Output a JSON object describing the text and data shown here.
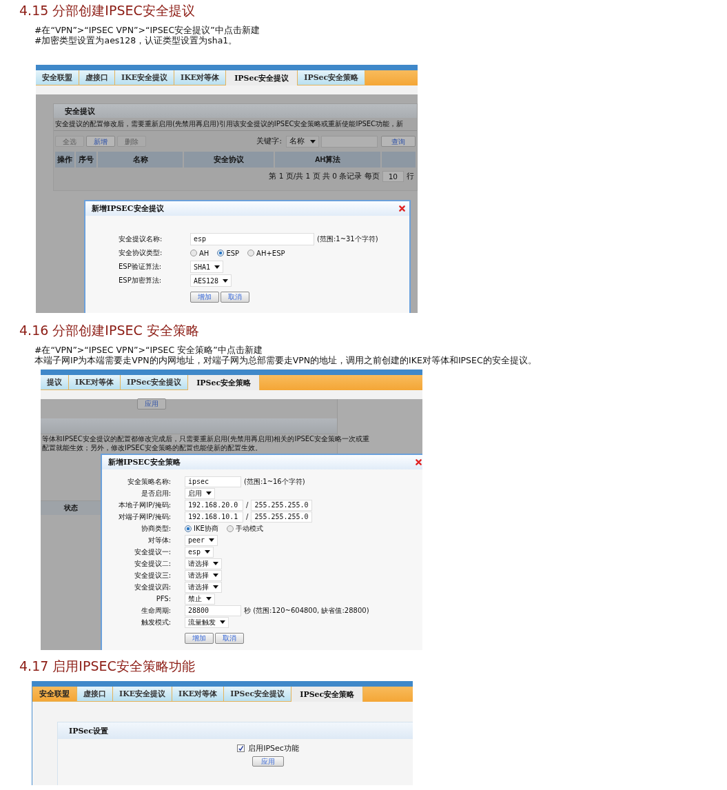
{
  "sections": [
    {
      "heading": "4.15  分部创建IPSEC安全提议",
      "notes": [
        "#在“VPN”>“IPSEC VPN”>“IPSEC安全提议”中点击新建",
        "#加密类型设置为aes128，认证类型设置为sha1。"
      ],
      "screenshot": {
        "kind": "proposal_list",
        "tabs": [
          {
            "label": "安全联盟",
            "selected": false
          },
          {
            "label": "虚接口",
            "selected": false
          },
          {
            "label": "IKE安全提议",
            "selected": false
          },
          {
            "label": "IKE对等体",
            "selected": false
          },
          {
            "label": "IPSec安全提议",
            "selected": true
          },
          {
            "label": "IPSec安全策略",
            "selected": false
          }
        ],
        "panel_title": "安全提议",
        "notice_lines": [
          "安全提议的配置修改后，需要重新启用(先禁用再启用)引用该安全提议的IPSEC安全策略或重新使能IPSEC功能，新"
        ],
        "toolbar_buttons": [
          {
            "label": "全选",
            "disabled": true
          },
          {
            "label": "新增",
            "disabled": false
          },
          {
            "label": "删除",
            "disabled": true
          }
        ],
        "search": {
          "label": "关键字:",
          "field": "名称",
          "button": "查询"
        },
        "columns": [
          "操作",
          "序号",
          "名称",
          "安全协议",
          "AH算法"
        ],
        "pager": {
          "before": "第 1 页/共 1 页 共 0 条记录 每页",
          "per_page": "10",
          "after": "行"
        },
        "dialog": {
          "title": "新增IPSEC安全提议",
          "fields": [
            {
              "kind": "text",
              "label": "安全提议名称:",
              "value": "esp",
              "hint": "(范围:1~31个字符)"
            },
            {
              "kind": "radio",
              "label": "安全协议类型:",
              "options": [
                {
                  "label": "AH",
                  "selected": false
                },
                {
                  "label": "ESP",
                  "selected": true
                },
                {
                  "label": "AH+ESP",
                  "selected": false
                }
              ]
            },
            {
              "kind": "select",
              "label": "ESP验证算法:",
              "value": "SHA1"
            },
            {
              "kind": "select",
              "label": "ESP加密算法:",
              "value": "AES128"
            }
          ],
          "buttons": [
            "增加",
            "取消"
          ]
        }
      }
    },
    {
      "heading": "4.16  分部创建IPSEC 安全策略",
      "notes": [
        "#在“VPN”>“IPSEC VPN”>“IPSEC 安全策略”中点击新建",
        "本端子网IP为本端需要走VPN的内网地址，对端子网为总部需要走VPN的地址，调用之前创建的IKE对等体和IPSEC的安全提议。"
      ],
      "screenshot": {
        "kind": "policy_list",
        "tabs": [
          {
            "label": "提议",
            "selected": false
          },
          {
            "label": "IKE对等体",
            "selected": false
          },
          {
            "label": "IPSec安全提议",
            "selected": false
          },
          {
            "label": "IPSec安全策略",
            "selected": true
          }
        ],
        "apply_button": "应用",
        "notice_lines": [
          "等体和IPSEC安全提议的配置都修改完成后，只需要重新启用(先禁用再启用)相关的IPSEC安全策略一次或重",
          "配置就能生效；另外，修改IPSEC安全策略的配置也能使新的配置生效。"
        ],
        "columns": [
          "状态"
        ],
        "dialog": {
          "title": "新增IPSEC安全策略",
          "fields": [
            {
              "kind": "text",
              "label": "安全策略名称:",
              "value": "ipsec",
              "hint": "(范围:1~16个字符)"
            },
            {
              "kind": "select",
              "label": "是否启用:",
              "value": "启用"
            },
            {
              "kind": "ip_pair",
              "label": "本地子网IP/掩码:",
              "value": "192.168.20.0",
              "separator": "/",
              "value2": "255.255.255.0"
            },
            {
              "kind": "ip_pair",
              "label": "对端子网IP/掩码:",
              "value": "192.168.10.1",
              "separator": "/",
              "value2": "255.255.255.0"
            },
            {
              "kind": "radio",
              "label": "协商类型:",
              "options": [
                {
                  "label": "IKE协商",
                  "selected": true
                },
                {
                  "label": "手动模式",
                  "selected": false
                }
              ]
            },
            {
              "kind": "select",
              "label": "对等体:",
              "value": "peer"
            },
            {
              "kind": "select",
              "label": "安全提议一:",
              "value": "esp"
            },
            {
              "kind": "select",
              "label": "安全提议二:",
              "value": "请选择"
            },
            {
              "kind": "select",
              "label": "安全提议三:",
              "value": "请选择"
            },
            {
              "kind": "select",
              "label": "安全提议四:",
              "value": "请选择"
            },
            {
              "kind": "select",
              "label": "PFS:",
              "value": "禁止"
            },
            {
              "kind": "text",
              "label": "生命周期:",
              "value": "28800",
              "hint": "秒 (范围:120~604800, 缺省值:28800)"
            },
            {
              "kind": "select",
              "label": "触发模式:",
              "value": "流量触发"
            }
          ],
          "buttons": [
            "增加",
            "取消"
          ]
        }
      }
    },
    {
      "heading": "4.17  启用IPSEC安全策略功能",
      "screenshot": {
        "kind": "ipsec_settings",
        "tabs": [
          {
            "label": "安全联盟",
            "selected": false,
            "hover": true
          },
          {
            "label": "虚接口",
            "selected": false
          },
          {
            "label": "IKE安全提议",
            "selected": false
          },
          {
            "label": "IKE对等体",
            "selected": false
          },
          {
            "label": "IPSec安全提议",
            "selected": false
          },
          {
            "label": "IPSec安全策略",
            "selected": true
          }
        ],
        "panel_title": "IPSec设置",
        "checkbox": {
          "label": "启用IPSec功能",
          "checked": true
        },
        "apply_button": "应用"
      }
    }
  ]
}
